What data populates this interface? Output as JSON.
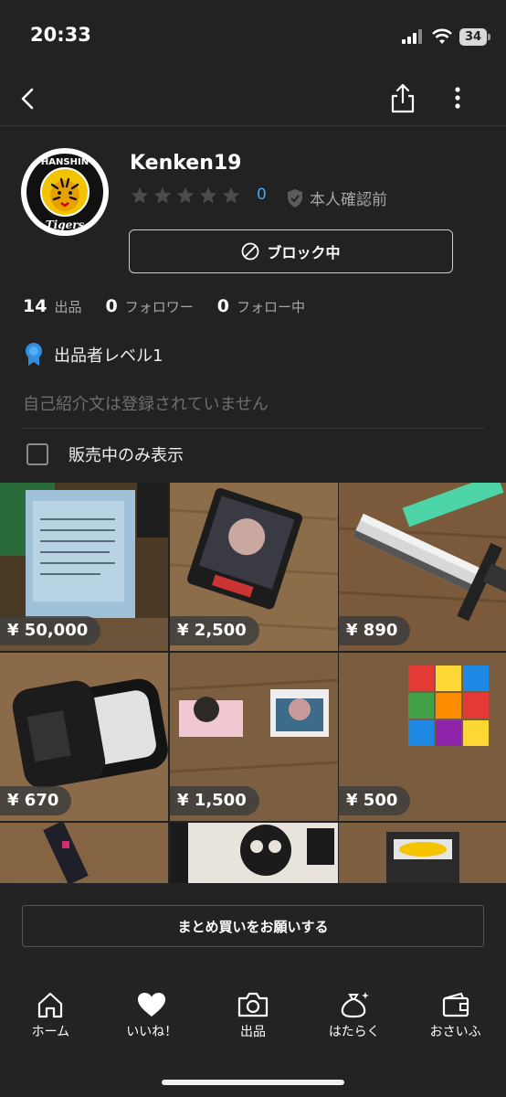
{
  "status_bar": {
    "time": "20:33",
    "battery": "34"
  },
  "profile": {
    "username": "Kenken19",
    "rating_count": "0",
    "verification": "本人確認前",
    "block_label": "ブロック中",
    "avatar_logo_top": "HANSHIN",
    "avatar_logo_bottom": "Tigers"
  },
  "stats": [
    {
      "num": "14",
      "label": "出品"
    },
    {
      "num": "0",
      "label": "フォロワー"
    },
    {
      "num": "0",
      "label": "フォロー中"
    }
  ],
  "seller_level": "出品者レベル1",
  "bio_placeholder": "自己紹介文は登録されていません",
  "filter_label": "販売中のみ表示",
  "items": [
    {
      "price": "¥ 50,000"
    },
    {
      "price": "¥ 2,500"
    },
    {
      "price": "¥ 890"
    },
    {
      "price": "¥ 670"
    },
    {
      "price": "¥ 1,500"
    },
    {
      "price": "¥ 500"
    }
  ],
  "bulk_buy_label": "まとめ買いをお願いする",
  "tabs": [
    {
      "label": "ホーム",
      "icon": "home-icon"
    },
    {
      "label": "いいね！",
      "icon": "heart-icon"
    },
    {
      "label": "出品",
      "icon": "camera-icon"
    },
    {
      "label": "はたらく",
      "icon": "money-bag-icon"
    },
    {
      "label": "おさいふ",
      "icon": "wallet-icon"
    }
  ],
  "colors": {
    "background": "#222222",
    "accent": "#3fa6ff",
    "muted": "#a6a6a6"
  }
}
